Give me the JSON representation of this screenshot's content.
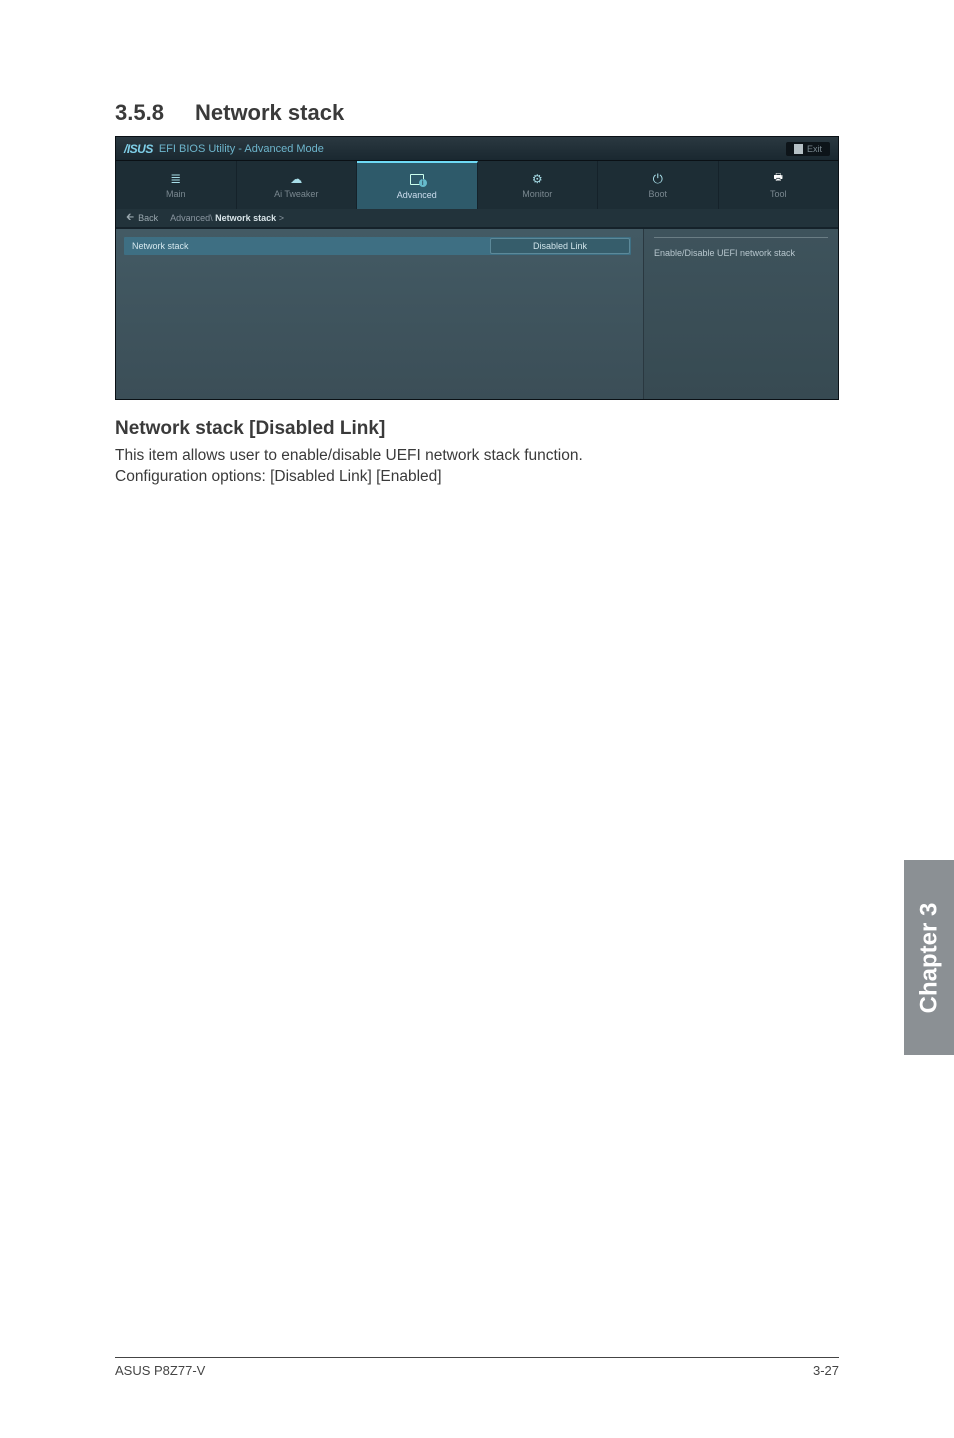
{
  "section": {
    "number": "3.5.8",
    "title": "Network stack"
  },
  "bios": {
    "titlebar": {
      "logo": "/ISUS",
      "title": "EFI BIOS Utility - Advanced Mode",
      "exit_label": "Exit"
    },
    "tabs": {
      "main": "Main",
      "ai_tweaker": "Ai  Tweaker",
      "advanced": "Advanced",
      "monitor": "Monitor",
      "boot": "Boot",
      "tool": "Tool"
    },
    "breadcrumb": {
      "back": "Back",
      "path_prefix": "Advanced\\ ",
      "path_active": "Network stack",
      "path_suffix": "  >"
    },
    "setting": {
      "label": "Network stack",
      "value": "Disabled Link"
    },
    "help": "Enable/Disable UEFI network stack"
  },
  "doc": {
    "sub_heading": "Network stack [Disabled Link]",
    "line1": "This item allows user to enable/disable UEFI network stack function.",
    "line2": "Configuration options: [Disabled Link] [Enabled]"
  },
  "chapter_tab": "Chapter 3",
  "footer": {
    "left": "ASUS P8Z77-V",
    "right": "3-27"
  }
}
